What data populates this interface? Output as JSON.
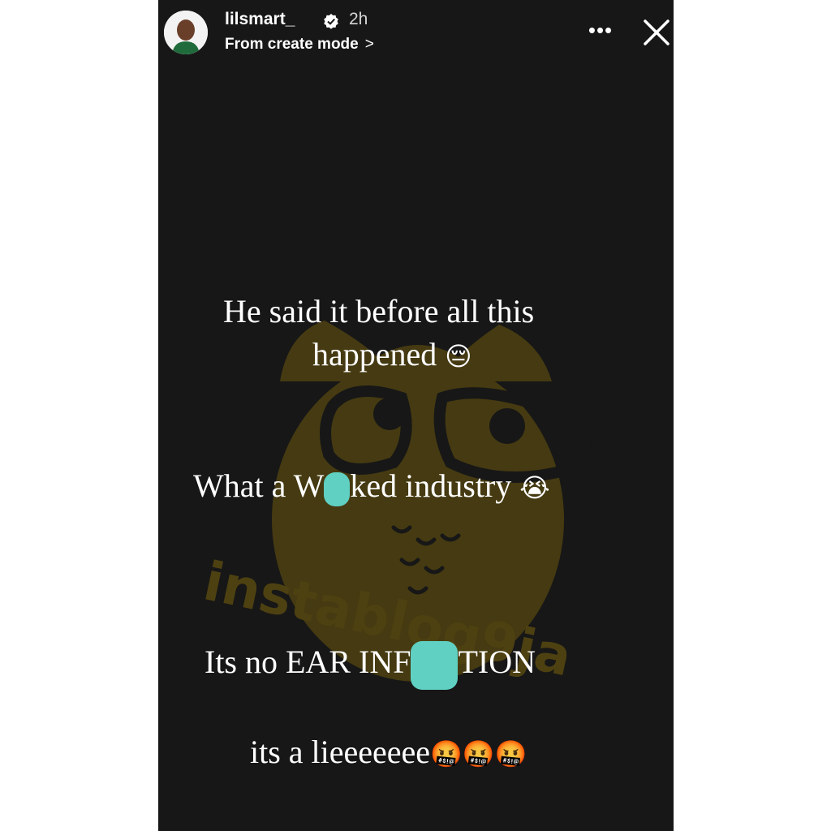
{
  "header": {
    "username": "lilsmart_",
    "timestamp": "2h",
    "mode_text": "From create mode",
    "mode_chevron": ">",
    "more_label": "•••"
  },
  "icons": {
    "avatar": "profile-photo",
    "verified": "verified-badge-icon",
    "more": "more-options-icon",
    "close": "close-icon"
  },
  "story": {
    "line1": "He said it before all this",
    "line2": "happened",
    "line2_emoji": "😔",
    "line3_start": "What a W",
    "line3_end": "ked industry",
    "line3_emoji": "😭",
    "line4_start": "Its no EAR INF",
    "line4_end": "TION",
    "line5": "its a lieeeeeee",
    "line5_emoji": "🤬🤬🤬"
  },
  "watermark": {
    "text": "instablog9ja"
  },
  "colors": {
    "story_background": "#171717",
    "text": "#ffffff",
    "scribble": "#5fd0c2",
    "watermark": "#5a4a10"
  }
}
